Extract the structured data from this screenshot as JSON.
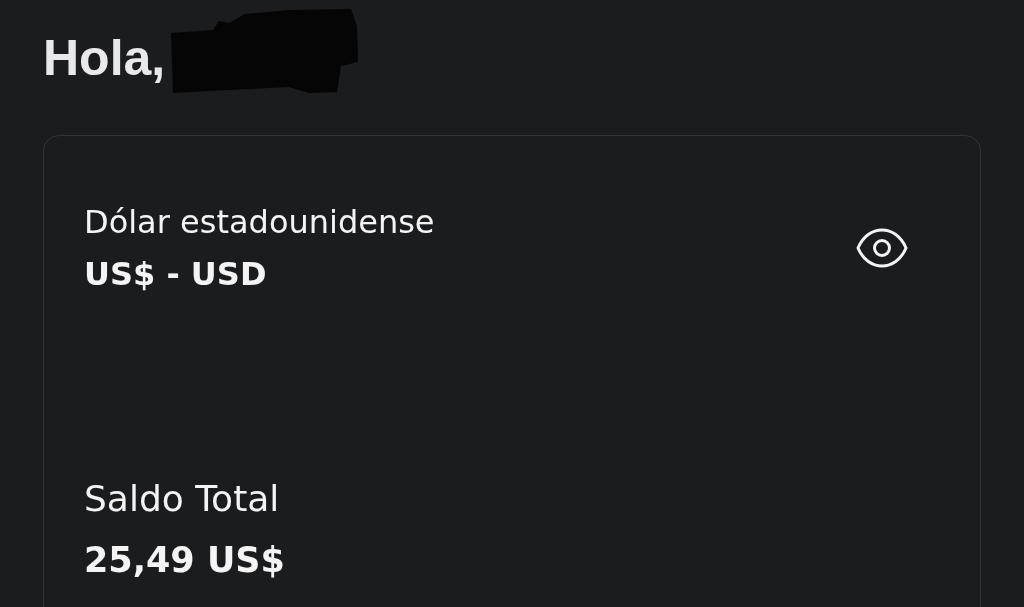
{
  "greeting": {
    "text": "Hola,",
    "name_redacted": true
  },
  "account_card": {
    "currency_name": "Dólar estadounidense",
    "currency_code": "US$ - USD",
    "balance_label": "Saldo Total",
    "balance": "25,49 US$"
  }
}
